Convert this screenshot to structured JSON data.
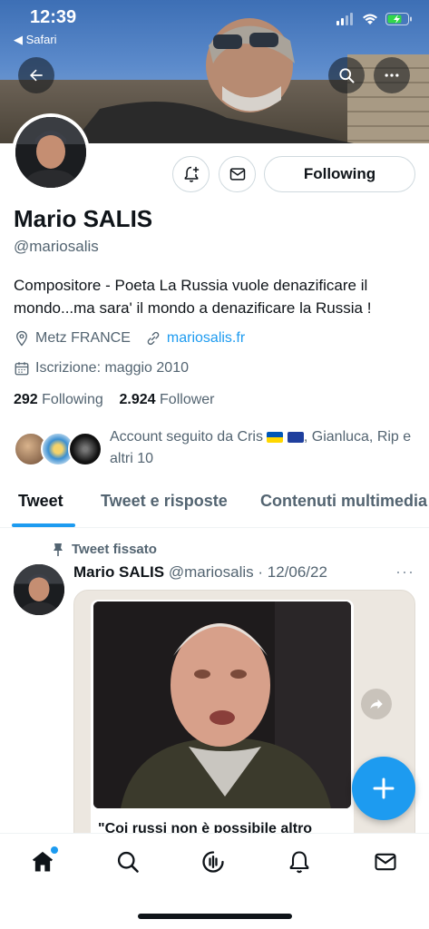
{
  "status_bar": {
    "time": "12:39",
    "back_app": "◀ Safari"
  },
  "profile": {
    "name": "Mario SALIS",
    "handle": "@mariosalis",
    "bio": "Compositore - Poeta La Russia vuole denazificare il mondo...ma sara' il mondo a denazificare la Russia !",
    "location": "Metz FRANCE",
    "website": "mariosalis.fr",
    "joined": "Iscrizione: maggio 2010",
    "following_count": "292",
    "following_label": "Following",
    "followers_count": "2.924",
    "followers_label": "Follower",
    "followed_by_prefix": "Account seguito da Cris",
    "followed_by_suffix": ", Gianluca, Rip e altri 10",
    "follow_button_label": "Following"
  },
  "tabs": [
    "Tweet",
    "Tweet e risposte",
    "Contenuti multimedia"
  ],
  "active_tab": "Tweet",
  "pinned_tweet": {
    "pinned_label": "Tweet fissato",
    "author_name": "Mario SALIS",
    "author_handle": "@mariosalis",
    "date": "· 12/06/22",
    "more": "···",
    "media_caption": "\"Coi russi non è possibile altro"
  },
  "icons": {
    "back": "arrow-left-icon",
    "search": "search-icon",
    "more": "more-icon",
    "notify": "bell-plus-icon",
    "message": "envelope-icon",
    "location": "location-pin-icon",
    "link": "link-icon",
    "calendar": "calendar-icon",
    "pin": "pin-icon",
    "share": "share-arrow-icon",
    "compose": "plus-icon",
    "nav": [
      "home-icon",
      "search-icon",
      "spaces-icon",
      "bell-icon",
      "envelope-icon"
    ]
  },
  "colors": {
    "accent": "#1d9bf0",
    "text": "#0f1419",
    "secondary": "#536471"
  }
}
